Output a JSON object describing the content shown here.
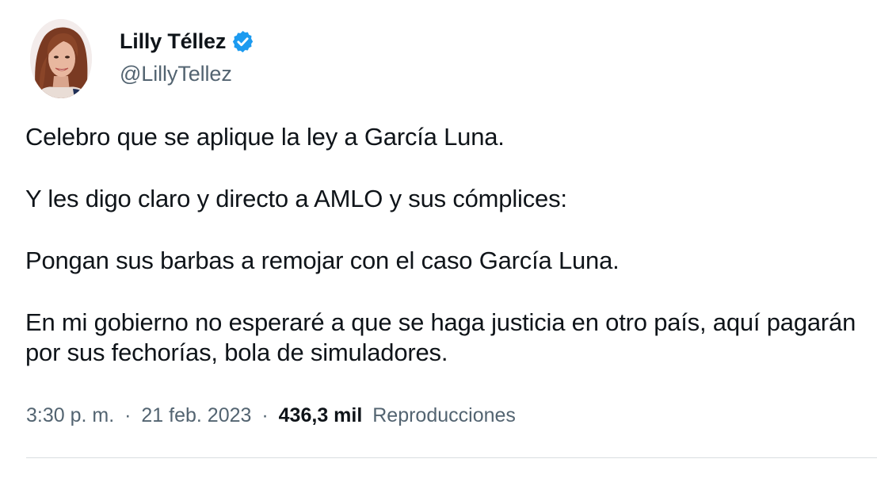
{
  "author": {
    "display_name": "Lilly Téllez",
    "handle": "@LillyTellez",
    "verified": true,
    "verified_color": "#1d9bf0",
    "avatar_icon": "profile-photo"
  },
  "tweet": {
    "paragraphs": [
      "Celebro que se aplique la ley a García Luna.",
      "Y les digo claro y directo a AMLO y sus cómplices:",
      "Pongan sus barbas a remojar con el caso García Luna.",
      "En mi gobierno no esperaré a que se haga justicia en otro país, aquí pagarán por sus fechorías, bola de simuladores."
    ]
  },
  "meta": {
    "time": "3:30 p. m.",
    "separator": "·",
    "date": "21 feb. 2023",
    "views_count": "436,3 mil",
    "views_label": "Reproducciones"
  },
  "colors": {
    "text_primary": "#0f1419",
    "text_secondary": "#536471",
    "divider": "#d9dde1"
  }
}
